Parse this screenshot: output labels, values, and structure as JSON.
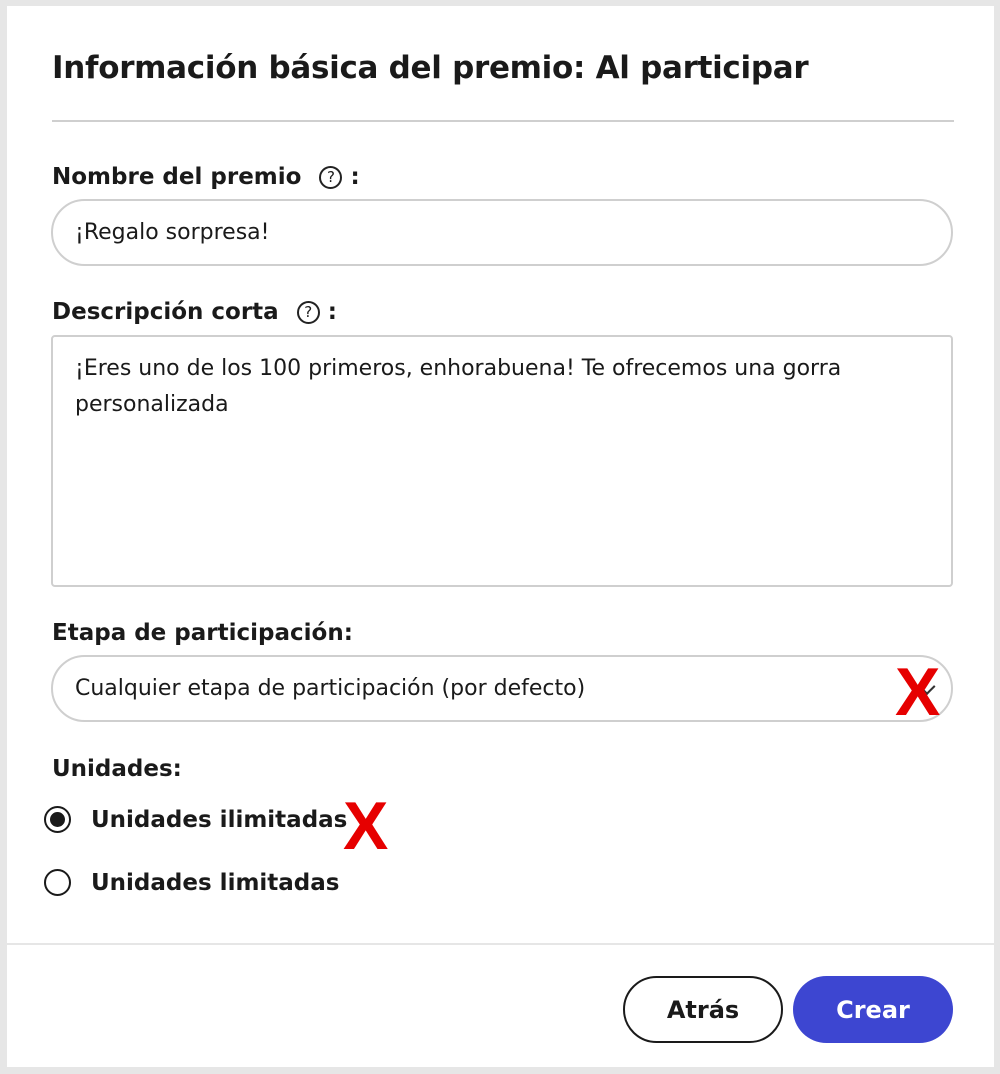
{
  "dialog": {
    "title": "Información básica del premio: Al participar"
  },
  "prize_name": {
    "label": "Nombre del premio",
    "help_icon": "?",
    "colon": ":",
    "value": "¡Regalo sorpresa!"
  },
  "short_description": {
    "label": "Descripción corta",
    "help_icon": "?",
    "colon": ":",
    "value": "¡Eres uno de los 100 primeros, enhorabuena! Te ofrecemos una gorra personalizada"
  },
  "participation_stage": {
    "label": "Etapa de participación:",
    "selected": "Cualquier etapa de participación (por defecto)"
  },
  "units": {
    "label": "Unidades:",
    "options": [
      {
        "label": "Unidades ilimitadas",
        "checked": true
      },
      {
        "label": "Unidades limitadas",
        "checked": false
      }
    ]
  },
  "annotations": {
    "mark": "X",
    "color": "#e60000"
  },
  "footer": {
    "back_label": "Atrás",
    "create_label": "Crear"
  },
  "colors": {
    "primary": "#3d46d1",
    "border": "#cfcfcf"
  }
}
